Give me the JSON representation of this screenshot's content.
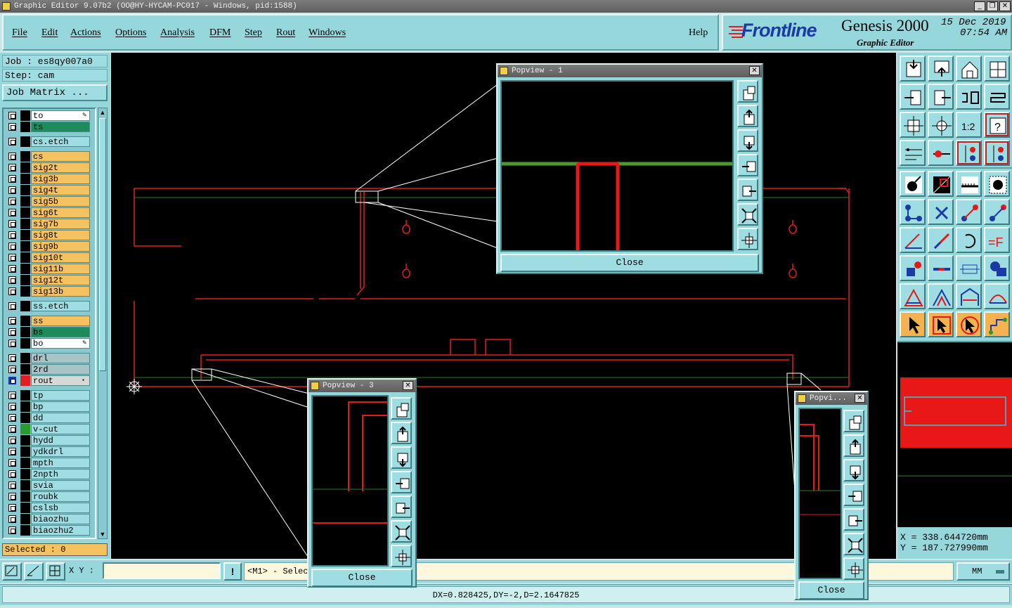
{
  "window": {
    "title": "Graphic Editor 9.07b2 (OO@HY-HYCAM-PC017 - Windows, pid:1588)"
  },
  "menu": [
    "File",
    "Edit",
    "Actions",
    "Options",
    "Analysis",
    "DFM",
    "Step",
    "Rout",
    "Windows"
  ],
  "help_label": "Help",
  "logo": {
    "brand": "Frontline",
    "product": "Genesis 2000",
    "subtitle": "Graphic Editor",
    "date": "15 Dec 2019",
    "time": "07:54 AM"
  },
  "job": {
    "label": "Job : es8qy007a0",
    "step": "Step: cam",
    "matrix_button": "Job Matrix ..."
  },
  "layers": [
    {
      "name": "to",
      "bg": "#ffffff",
      "color": "#000000",
      "marker": "edit"
    },
    {
      "name": "ts",
      "bg": "#1e8c5a",
      "color": "#000000"
    },
    {
      "name": "cs.etch",
      "bg": "#9edde1",
      "color": "#000000",
      "gap": true
    },
    {
      "name": "cs",
      "bg": "#f6c25f",
      "color": "#000000",
      "gap": true
    },
    {
      "name": "sig2t",
      "bg": "#f6c25f",
      "color": "#000000"
    },
    {
      "name": "sig3b",
      "bg": "#f6c25f",
      "color": "#000000"
    },
    {
      "name": "sig4t",
      "bg": "#f6c25f",
      "color": "#000000"
    },
    {
      "name": "sig5b",
      "bg": "#f6c25f",
      "color": "#000000"
    },
    {
      "name": "sig6t",
      "bg": "#f6c25f",
      "color": "#000000"
    },
    {
      "name": "sig7b",
      "bg": "#f6c25f",
      "color": "#000000"
    },
    {
      "name": "sig8t",
      "bg": "#f6c25f",
      "color": "#000000"
    },
    {
      "name": "sig9b",
      "bg": "#f6c25f",
      "color": "#000000"
    },
    {
      "name": "sig10t",
      "bg": "#f6c25f",
      "color": "#000000"
    },
    {
      "name": "sig11b",
      "bg": "#f6c25f",
      "color": "#000000"
    },
    {
      "name": "sig12t",
      "bg": "#f6c25f",
      "color": "#000000"
    },
    {
      "name": "sig13b",
      "bg": "#f6c25f",
      "color": "#000000"
    },
    {
      "name": "ss.etch",
      "bg": "#9edde1",
      "color": "#000000",
      "gap": true
    },
    {
      "name": "ss",
      "bg": "#f6c25f",
      "color": "#000000",
      "gap": true
    },
    {
      "name": "bs",
      "bg": "#1e8c5a",
      "color": "#000000"
    },
    {
      "name": "bo",
      "bg": "#ffffff",
      "color": "#000000",
      "marker": "edit"
    },
    {
      "name": "drl",
      "bg": "#a9c3c6",
      "color": "#000000",
      "gap": true
    },
    {
      "name": "2rd",
      "bg": "#a9c3c6",
      "color": "#000000"
    },
    {
      "name": "rout",
      "bg": "#d8d8d8",
      "color": "#e02020",
      "checked": true,
      "marker": "sq"
    },
    {
      "name": "tp",
      "bg": "#9edde1",
      "color": "#000000",
      "gap": true
    },
    {
      "name": "bp",
      "bg": "#9edde1",
      "color": "#000000"
    },
    {
      "name": "dd",
      "bg": "#9edde1",
      "color": "#000000"
    },
    {
      "name": "v-cut",
      "bg": "#9edde1",
      "color": "#2a9a2a"
    },
    {
      "name": "hydd",
      "bg": "#9edde1",
      "color": "#000000"
    },
    {
      "name": "ydkdrl",
      "bg": "#9edde1",
      "color": "#000000"
    },
    {
      "name": "mpth",
      "bg": "#9edde1",
      "color": "#000000"
    },
    {
      "name": "2npth",
      "bg": "#9edde1",
      "color": "#000000"
    },
    {
      "name": "svia",
      "bg": "#9edde1",
      "color": "#000000"
    },
    {
      "name": "roubk",
      "bg": "#9edde1",
      "color": "#000000"
    },
    {
      "name": "cslsb",
      "bg": "#9edde1",
      "color": "#000000"
    },
    {
      "name": "biaozhu",
      "bg": "#9edde1",
      "color": "#000000"
    },
    {
      "name": "biaozhu2",
      "bg": "#9edde1",
      "color": "#000000"
    }
  ],
  "selected": "Selected : 0",
  "xy_label": "X Y :",
  "xy_value": "",
  "prompt": "<M1> - Selec",
  "units": "MM",
  "status": "DX=0.828425,DY=-2,D=2.1647825",
  "coords": {
    "x": "X = 338.644720mm",
    "y": "Y = 187.727990mm"
  },
  "popups": [
    {
      "title": "Popview - 1",
      "close": "Close"
    },
    {
      "title": "Popview - 3",
      "close": "Close"
    },
    {
      "title": "Popvi...",
      "close": "Close"
    }
  ],
  "tool_icons": [
    "zoom-page-icon",
    "zoom-home-icon",
    "home-icon",
    "window-icon",
    "pan-left-icon",
    "pan-right-icon",
    "snap-icon",
    "route-icon",
    "fit-icon",
    "center-icon",
    "one-to-one-icon",
    "help-icon",
    "measure-icon",
    "connect-icon",
    "pad-red-icon",
    "pad-red2-icon",
    "arrow-icon",
    "diag-icon",
    "ruler-icon",
    "pad-circle-icon",
    "node-icon",
    "cross-icon",
    "node-red-icon",
    "node-red2-icon",
    "angle-icon",
    "line-icon",
    "arc-icon",
    "text-f-icon",
    "pad-sq-icon",
    "line-red-icon",
    "dim-icon",
    "blob-icon",
    "tri-icon",
    "tri2-icon",
    "tri3-icon",
    "tri4-icon",
    "pointer-icon",
    "pointer2-icon",
    "pointer3-icon",
    "net-icon"
  ]
}
